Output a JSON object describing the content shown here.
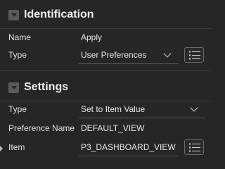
{
  "identification": {
    "title": "Identification",
    "name_label": "Name",
    "name_value": "Apply",
    "type_label": "Type",
    "type_value": "User Preferences"
  },
  "settings": {
    "title": "Settings",
    "type_label": "Type",
    "type_value": "Set to Item Value",
    "preference_name_label": "Preference Name",
    "preference_name_value": "DEFAULT_VIEW",
    "item_label": "Item",
    "item_value": "P3_DASHBOARD_VIEW"
  },
  "icons": {
    "collapse": "chevron-down-icon",
    "dropdown": "chevron-down-icon",
    "list_picker": "list-icon"
  },
  "colors": {
    "background": "#262626",
    "text": "#e6e6e6",
    "divider": "#3a3a3a"
  }
}
